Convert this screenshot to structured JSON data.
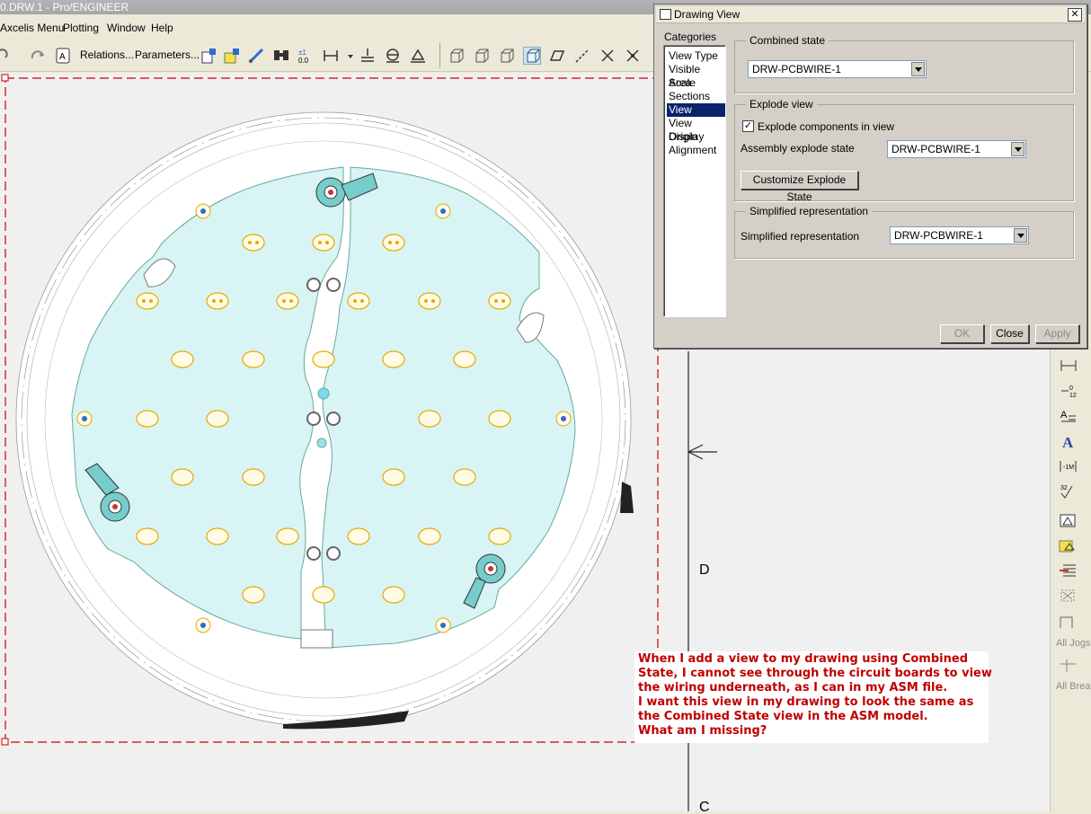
{
  "window": {
    "title": "0.DRW.1 - Pro/ENGINEER"
  },
  "menu": [
    "Axcelis Menu",
    "Plotting",
    "Window",
    "Help"
  ],
  "toolbar": {
    "relations_label": "Relations...",
    "parameters_label": "Parameters..."
  },
  "drawing": {
    "labels": {
      "zone_d": "D",
      "zone_c": "C"
    },
    "overlay_note": {
      "lines": [
        "When I add a view to my drawing using Combined",
        "State, I cannot see through the circuit boards to view",
        "the wiring underneath, as I can in my ASM file.",
        "I want this view in my drawing to look the same as",
        "the Combined State view in the ASM model.",
        "What am I missing?"
      ],
      "color": "#c00000"
    }
  },
  "right_toolbar": {
    "all_jogs": "All Jogs",
    "all_breaks": "All Breal"
  },
  "dialog": {
    "title": "Drawing View",
    "categories_label": "Categories",
    "categories": [
      "View Type",
      "Visible Area",
      "Scale",
      "Sections",
      "View States",
      "View Display",
      "Origin",
      "Alignment"
    ],
    "selected_category": "View States",
    "combined_state": {
      "group_title": "Combined state",
      "value": "DRW-PCBWIRE-1"
    },
    "explode_view": {
      "group_title": "Explode view",
      "checkbox_label": "Explode components in view",
      "checked": true,
      "state_label": "Assembly explode state",
      "state_value": "DRW-PCBWIRE-1",
      "customize_button": "Customize Explode State"
    },
    "simplified_rep": {
      "group_title": "Simplified representation",
      "label": "Simplified representation",
      "value": "DRW-PCBWIRE-1"
    },
    "buttons": {
      "ok": "OK",
      "close": "Close",
      "apply": "Apply"
    }
  },
  "colors": {
    "board": "#d8f4f4",
    "pad": "#e8a800",
    "border_dash": "#cc0000",
    "selection": "#0a246a"
  }
}
